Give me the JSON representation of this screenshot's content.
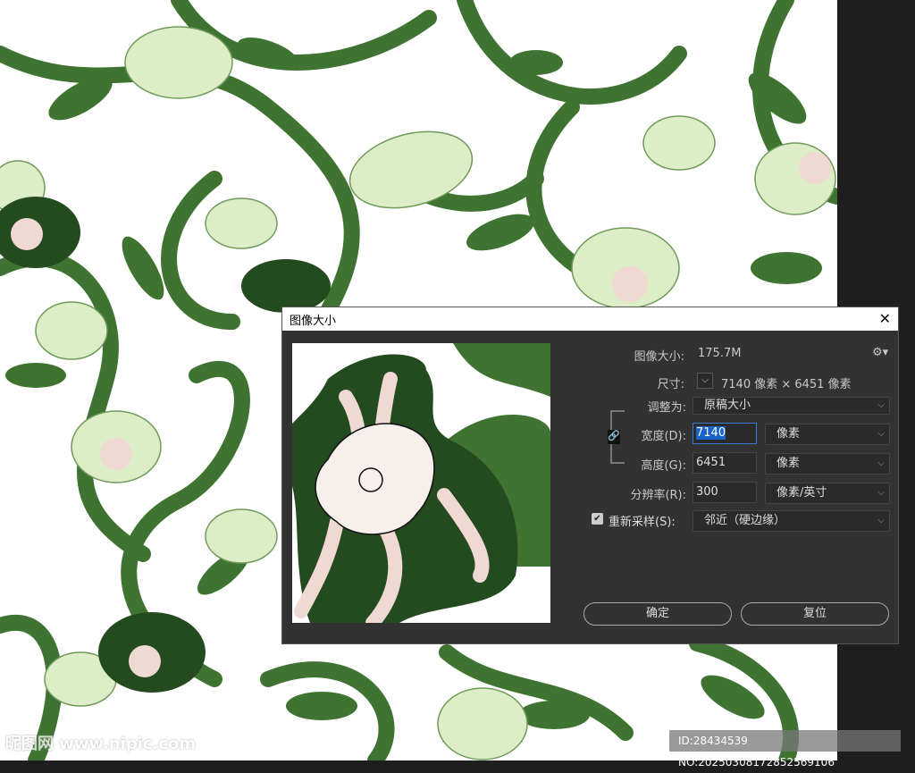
{
  "dialog": {
    "title": "图像大小",
    "close": "✕",
    "image_size_label": "图像大小:",
    "image_size_value": "175.7M",
    "dimensions_label": "尺寸:",
    "dimensions_value": "7140 像素 × 6451 像素",
    "fit_to_label": "调整为:",
    "fit_to_value": "原稿大小",
    "width_label": "宽度(D):",
    "width_value": "7140",
    "width_unit": "像素",
    "height_label": "高度(G):",
    "height_value": "6451",
    "height_unit": "像素",
    "resolution_label": "分辨率(R):",
    "resolution_value": "300",
    "resolution_unit": "像素/英寸",
    "resample_label": "重新采样(S):",
    "resample_checked": true,
    "resample_value": "邻近（硬边缘）",
    "ok_label": "确定",
    "reset_label": "复位"
  },
  "watermark": {
    "logo": "昵图网 www.nipic.com",
    "id": "ID:28434539 NO:20250308172852569106"
  },
  "colors": {
    "leaf": "#3f7332",
    "dark_leaf": "#244a1f",
    "petal": "#efd9d2",
    "bud": "#dcedc8"
  }
}
